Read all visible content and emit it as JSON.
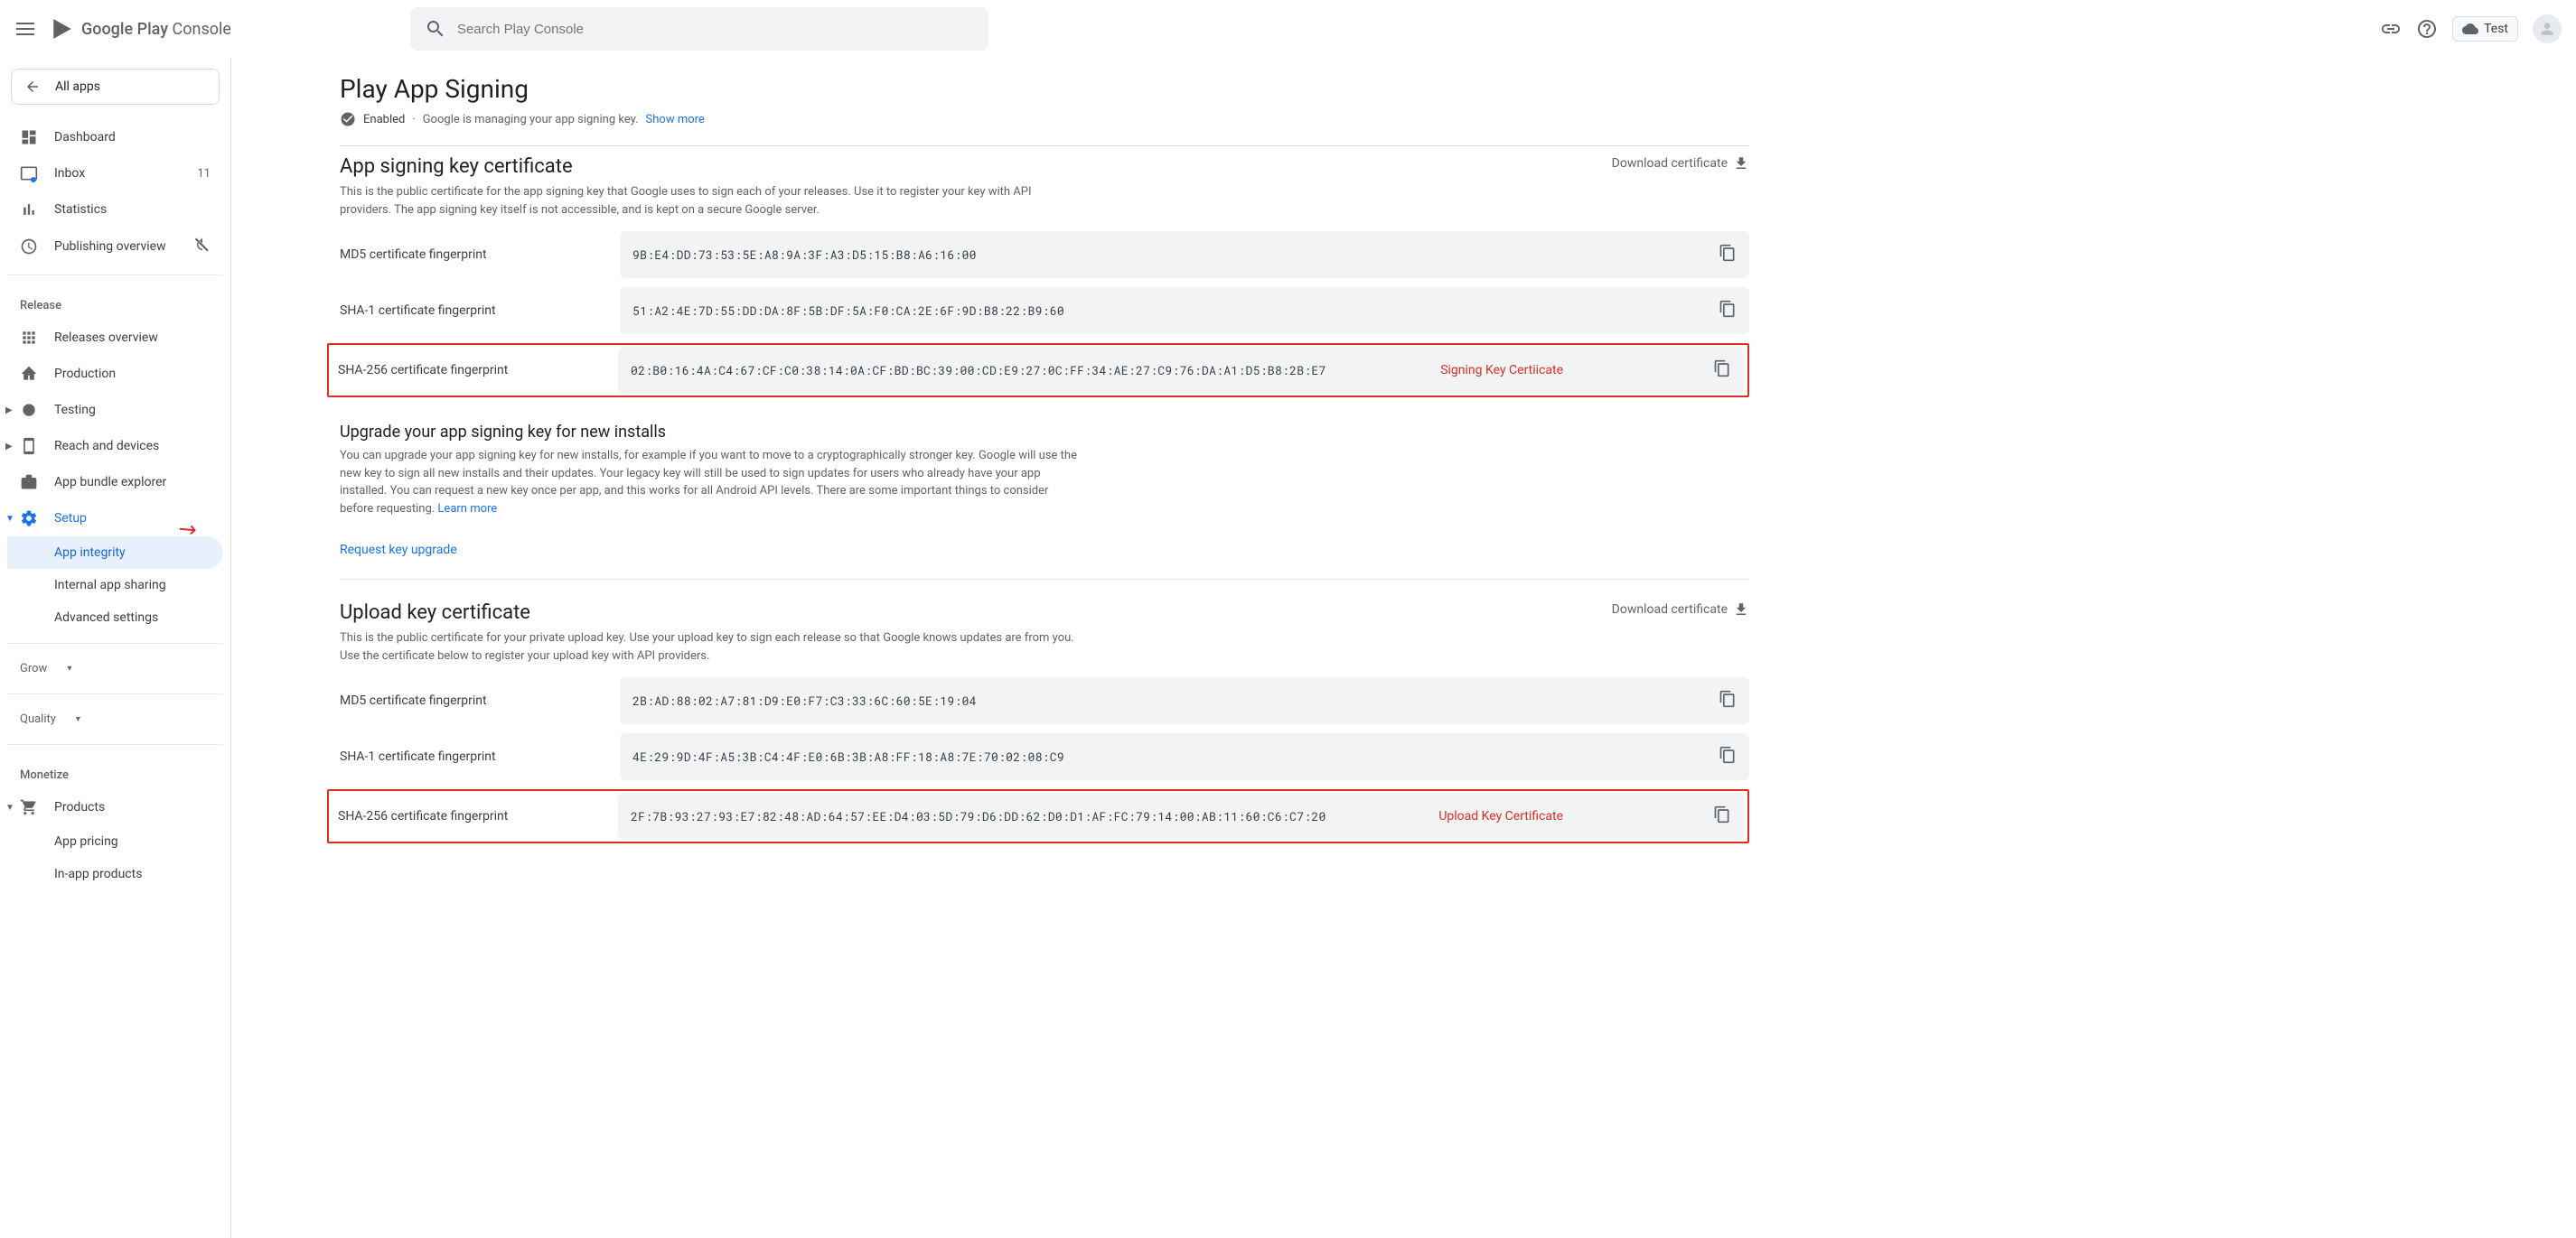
{
  "header": {
    "logo_b": "Google Play",
    "logo_light": " Console",
    "search_placeholder": "Search Play Console",
    "test_label": "Test"
  },
  "sidebar": {
    "all_apps": "All apps",
    "dashboard": "Dashboard",
    "inbox": "Inbox",
    "inbox_count": "11",
    "statistics": "Statistics",
    "pub_overview": "Publishing overview",
    "release_section": "Release",
    "releases_overview": "Releases overview",
    "production": "Production",
    "testing": "Testing",
    "reach": "Reach and devices",
    "app_bundle": "App bundle explorer",
    "setup": "Setup",
    "app_integrity": "App integrity",
    "internal_sharing": "Internal app sharing",
    "advanced_settings": "Advanced settings",
    "grow": "Grow",
    "quality": "Quality",
    "monetize": "Monetize",
    "products": "Products",
    "app_pricing": "App pricing",
    "in_app_products": "In-app products"
  },
  "page": {
    "title": "Play App Signing",
    "status_enabled": "Enabled",
    "status_sep": " · ",
    "status_detail": "Google is managing your app signing key.",
    "show_more": "Show more",
    "download_cert": "Download certificate",
    "section1": {
      "title": "App signing key certificate",
      "desc": "This is the public certificate for the app signing key that Google uses to sign each of your releases. Use it to register your key with API providers. The app signing key itself is not accessible, and is kept on a secure Google server."
    },
    "cert_labels": {
      "md5": "MD5 certificate fingerprint",
      "sha1": "SHA-1 certificate fingerprint",
      "sha256": "SHA-256 certificate fingerprint"
    },
    "signing": {
      "md5": "9B:E4:DD:73:53:5E:A8:9A:3F:A3:D5:15:B8:A6:16:00",
      "sha1": "51:A2:4E:7D:55:DD:DA:8F:5B:DF:5A:F0:CA:2E:6F:9D:B8:22:B9:60",
      "sha256": "02:B0:16:4A:C4:67:CF:C0:38:14:0A:CF:BD:BC:39:00:CD:E9:27:0C:FF:34:AE:27:C9:76:DA:A1:D5:B8:2B:E7",
      "sha256_annot": "Signing Key Certiicate"
    },
    "upgrade": {
      "title": "Upgrade your app signing key for new installs",
      "desc": "You can upgrade your app signing key for new installs, for example if you want to move to a cryptographically stronger key. Google will use the new key to sign all new installs and their updates. Your legacy key will still be used to sign updates for users who already have your app installed. You can request a new key once per app, and this works for all Android API levels. There are some important things to consider before requesting. ",
      "learn_more": "Learn more",
      "request": "Request key upgrade"
    },
    "section2": {
      "title": "Upload key certificate",
      "desc": "This is the public certificate for your private upload key. Use your upload key to sign each release so that Google knows updates are from you. Use the certificate below to register your upload key with API providers."
    },
    "upload": {
      "md5": "2B:AD:88:02:A7:81:D9:E0:F7:C3:33:6C:60:5E:19:04",
      "sha1": "4E:29:9D:4F:A5:3B:C4:4F:E0:6B:3B:A8:FF:18:A8:7E:70:02:08:C9",
      "sha256": "2F:7B:93:27:93:E7:82:48:AD:64:57:EE:D4:03:5D:79:D6:DD:62:D0:D1:AF:FC:79:14:00:AB:11:60:C6:C7:20",
      "sha256_annot": "Upload Key Certificate"
    }
  }
}
